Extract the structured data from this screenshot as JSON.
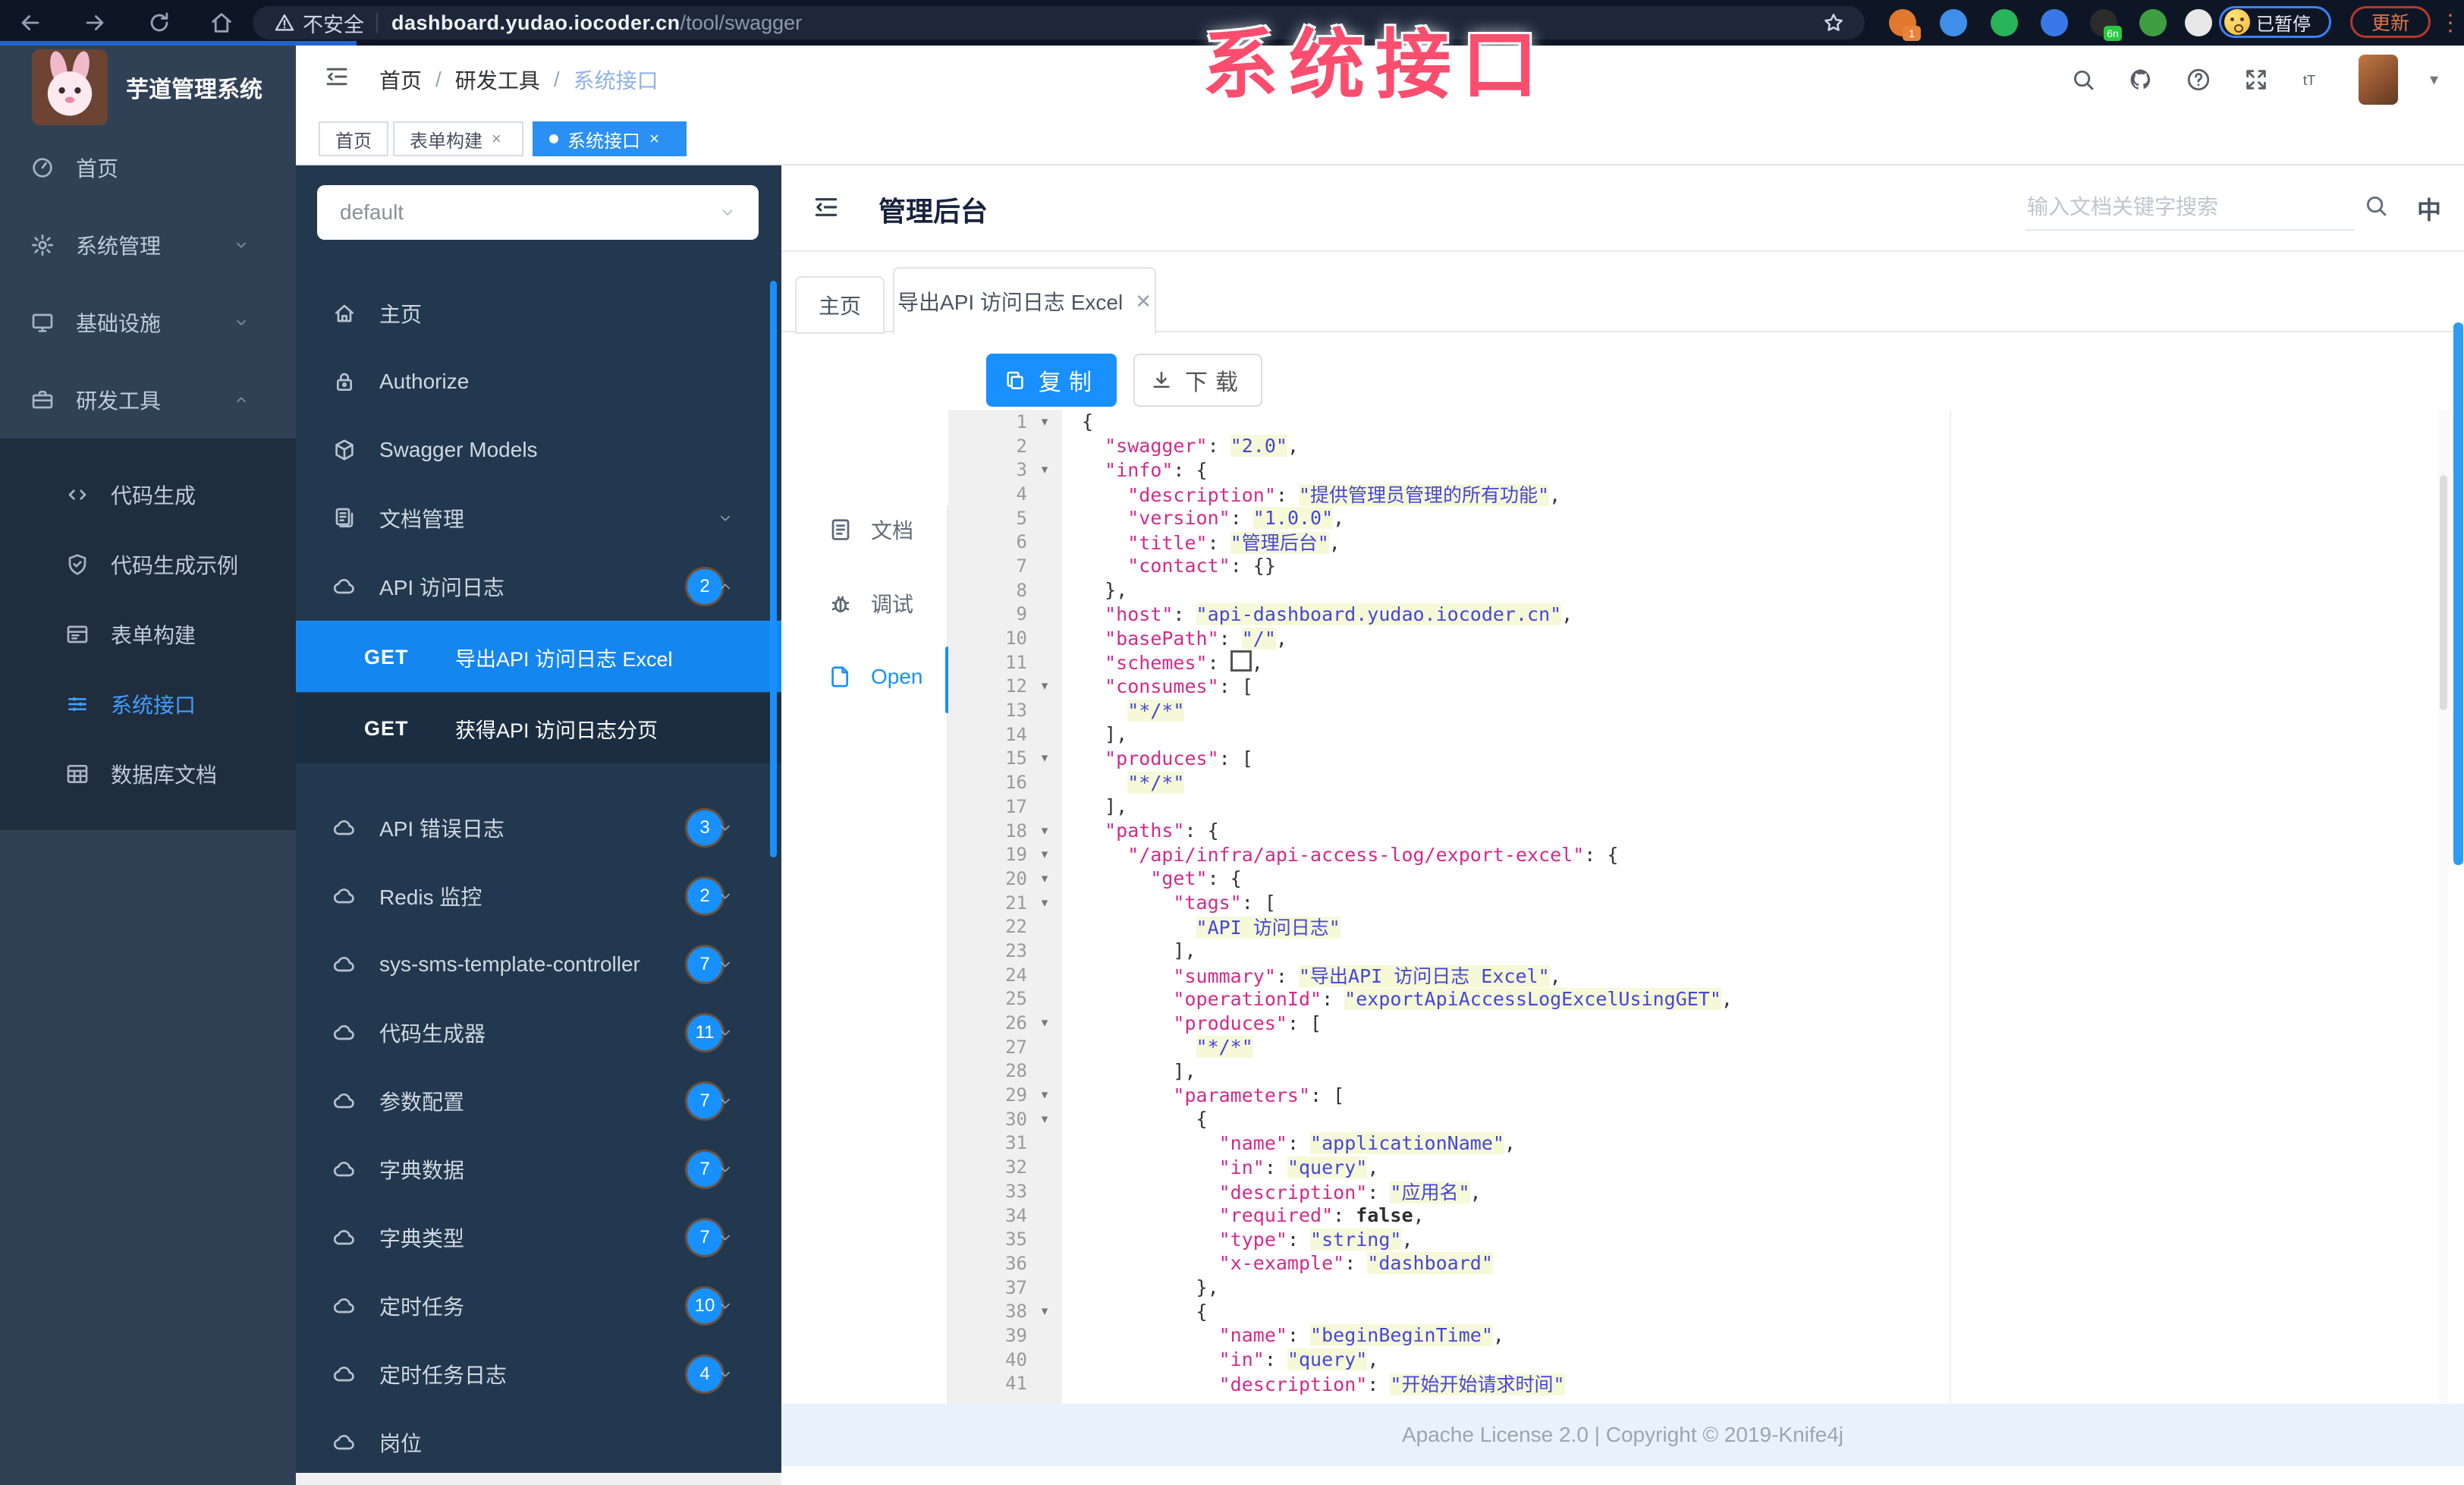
{
  "watermark": {
    "text": "系统接口"
  },
  "browser": {
    "security_label": "不安全",
    "url_host": "dashboard.yudao.iocoder.cn",
    "url_path": "/tool/swagger",
    "paused_badge": "已暂停",
    "update_label": "更新"
  },
  "app": {
    "logo_title": "芋道管理系统",
    "sidebar_items": [
      {
        "label": "首页",
        "icon": "dashboard"
      },
      {
        "label": "系统管理",
        "icon": "gear",
        "chevron": "down"
      },
      {
        "label": "基础设施",
        "icon": "monitor",
        "chevron": "down"
      },
      {
        "label": "研发工具",
        "icon": "briefcase",
        "chevron": "up"
      }
    ],
    "sidebar_sub_items": [
      {
        "label": "代码生成",
        "icon": "code"
      },
      {
        "label": "代码生成示例",
        "icon": "shield"
      },
      {
        "label": "表单构建",
        "icon": "form"
      },
      {
        "label": "系统接口",
        "icon": "api",
        "active": true
      },
      {
        "label": "数据库文档",
        "icon": "db"
      }
    ],
    "breadcrumb": [
      "首页",
      "研发工具",
      "系统接口"
    ],
    "tags": [
      {
        "label": "首页"
      },
      {
        "label": "表单构建",
        "closable": true
      },
      {
        "label": "系统接口",
        "closable": true,
        "active": true
      }
    ]
  },
  "swagger": {
    "group_select": "default",
    "menu": [
      {
        "label": "主页",
        "icon": "home"
      },
      {
        "label": "Authorize",
        "icon": "lock"
      },
      {
        "label": "Swagger Models",
        "icon": "cube"
      },
      {
        "label": "文档管理",
        "icon": "docs",
        "chevron": "down"
      },
      {
        "label": "API 访问日志",
        "icon": "cloud",
        "badge": "2",
        "chevron": "up",
        "children": [
          {
            "method": "GET",
            "label": "导出API 访问日志 Excel",
            "active": true
          },
          {
            "method": "GET",
            "label": "获得API 访问日志分页"
          }
        ]
      },
      {
        "label": "API 错误日志",
        "icon": "cloud",
        "badge": "3",
        "chevron": "down"
      },
      {
        "label": "Redis 监控",
        "icon": "cloud",
        "badge": "2",
        "chevron": "down"
      },
      {
        "label": "sys-sms-template-controller",
        "icon": "cloud",
        "badge": "7",
        "chevron": "down"
      },
      {
        "label": "代码生成器",
        "icon": "cloud",
        "badge": "11",
        "chevron": "down"
      },
      {
        "label": "参数配置",
        "icon": "cloud",
        "badge": "7",
        "chevron": "down"
      },
      {
        "label": "字典数据",
        "icon": "cloud",
        "badge": "7",
        "chevron": "down"
      },
      {
        "label": "字典类型",
        "icon": "cloud",
        "badge": "7",
        "chevron": "down"
      },
      {
        "label": "定时任务",
        "icon": "cloud",
        "badge": "10",
        "chevron": "down"
      },
      {
        "label": "定时任务日志",
        "icon": "cloud",
        "badge": "4",
        "chevron": "down"
      },
      {
        "label": "岗位",
        "icon": "cloud",
        "partial": true
      }
    ]
  },
  "content": {
    "title": "管理后台",
    "search_placeholder": "输入文档关键字搜索",
    "lang_label": "中",
    "tabs": [
      {
        "label": "主页"
      },
      {
        "label": "导出API 访问日志 Excel",
        "closable": true,
        "active": true
      }
    ],
    "doc_nav": [
      {
        "label": "文档",
        "icon": "doc"
      },
      {
        "label": "调试",
        "icon": "bug"
      },
      {
        "label": "Open",
        "icon": "openfile",
        "active": true
      }
    ],
    "toolbar": {
      "copy": "复制",
      "download": "下载"
    },
    "footer": "Apache License 2.0 | Copyright © 2019-Knife4j"
  },
  "editor": {
    "lines": [
      {
        "n": 1,
        "f": 1,
        "t": [
          [
            "p",
            "{"
          ]
        ]
      },
      {
        "n": 2,
        "t": [
          [
            "p",
            "  "
          ],
          [
            "k",
            "\"swagger\""
          ],
          [
            "p",
            ": "
          ],
          [
            "v",
            "\"2.0\""
          ],
          [
            "p",
            ","
          ]
        ]
      },
      {
        "n": 3,
        "f": 1,
        "t": [
          [
            "p",
            "  "
          ],
          [
            "k",
            "\"info\""
          ],
          [
            "p",
            ": {"
          ]
        ]
      },
      {
        "n": 4,
        "t": [
          [
            "p",
            "    "
          ],
          [
            "k",
            "\"description\""
          ],
          [
            "p",
            ": "
          ],
          [
            "v",
            "\"提供管理员管理的所有功能\""
          ],
          [
            "p",
            ","
          ]
        ]
      },
      {
        "n": 5,
        "t": [
          [
            "p",
            "    "
          ],
          [
            "k",
            "\"version\""
          ],
          [
            "p",
            ": "
          ],
          [
            "v",
            "\"1.0.0\""
          ],
          [
            "p",
            ","
          ]
        ]
      },
      {
        "n": 6,
        "t": [
          [
            "p",
            "    "
          ],
          [
            "k",
            "\"title\""
          ],
          [
            "p",
            ": "
          ],
          [
            "v",
            "\"管理后台\""
          ],
          [
            "p",
            ","
          ]
        ]
      },
      {
        "n": 7,
        "t": [
          [
            "p",
            "    "
          ],
          [
            "k",
            "\"contact\""
          ],
          [
            "p",
            ": {}"
          ]
        ]
      },
      {
        "n": 8,
        "t": [
          [
            "p",
            "  },"
          ]
        ]
      },
      {
        "n": 9,
        "t": [
          [
            "p",
            "  "
          ],
          [
            "k",
            "\"host\""
          ],
          [
            "p",
            ": "
          ],
          [
            "v",
            "\"api-dashboard.yudao.iocoder.cn\""
          ],
          [
            "p",
            ","
          ]
        ]
      },
      {
        "n": 10,
        "t": [
          [
            "p",
            "  "
          ],
          [
            "k",
            "\"basePath\""
          ],
          [
            "p",
            ": "
          ],
          [
            "v",
            "\"/\""
          ],
          [
            "p",
            ","
          ]
        ]
      },
      {
        "n": 11,
        "t": [
          [
            "p",
            "  "
          ],
          [
            "k",
            "\"schemes\""
          ],
          [
            "p",
            ": "
          ],
          [
            "w",
            ""
          ],
          [
            "p",
            ","
          ]
        ]
      },
      {
        "n": 12,
        "f": 1,
        "t": [
          [
            "p",
            "  "
          ],
          [
            "k",
            "\"consumes\""
          ],
          [
            "p",
            ": ["
          ]
        ]
      },
      {
        "n": 13,
        "t": [
          [
            "p",
            "    "
          ],
          [
            "v",
            "\"*/*\""
          ]
        ]
      },
      {
        "n": 14,
        "t": [
          [
            "p",
            "  ],"
          ]
        ]
      },
      {
        "n": 15,
        "f": 1,
        "t": [
          [
            "p",
            "  "
          ],
          [
            "k",
            "\"produces\""
          ],
          [
            "p",
            ": ["
          ]
        ]
      },
      {
        "n": 16,
        "t": [
          [
            "p",
            "    "
          ],
          [
            "v",
            "\"*/*\""
          ]
        ]
      },
      {
        "n": 17,
        "t": [
          [
            "p",
            "  ],"
          ]
        ]
      },
      {
        "n": 18,
        "f": 1,
        "t": [
          [
            "p",
            "  "
          ],
          [
            "k",
            "\"paths\""
          ],
          [
            "p",
            ": {"
          ]
        ]
      },
      {
        "n": 19,
        "f": 1,
        "t": [
          [
            "p",
            "    "
          ],
          [
            "k",
            "\"/api/infra/api-access-log/export-excel\""
          ],
          [
            "p",
            ": {"
          ]
        ]
      },
      {
        "n": 20,
        "f": 1,
        "t": [
          [
            "p",
            "      "
          ],
          [
            "k",
            "\"get\""
          ],
          [
            "p",
            ": {"
          ]
        ]
      },
      {
        "n": 21,
        "f": 1,
        "t": [
          [
            "p",
            "        "
          ],
          [
            "k",
            "\"tags\""
          ],
          [
            "p",
            ": ["
          ]
        ]
      },
      {
        "n": 22,
        "t": [
          [
            "p",
            "          "
          ],
          [
            "v",
            "\"API 访问日志\""
          ]
        ]
      },
      {
        "n": 23,
        "t": [
          [
            "p",
            "        ],"
          ]
        ]
      },
      {
        "n": 24,
        "t": [
          [
            "p",
            "        "
          ],
          [
            "k",
            "\"summary\""
          ],
          [
            "p",
            ": "
          ],
          [
            "v",
            "\"导出API 访问日志 Excel\""
          ],
          [
            "p",
            ","
          ]
        ]
      },
      {
        "n": 25,
        "t": [
          [
            "p",
            "        "
          ],
          [
            "k",
            "\"operationId\""
          ],
          [
            "p",
            ": "
          ],
          [
            "v",
            "\"exportApiAccessLogExcelUsingGET\""
          ],
          [
            "p",
            ","
          ]
        ]
      },
      {
        "n": 26,
        "f": 1,
        "t": [
          [
            "p",
            "        "
          ],
          [
            "k",
            "\"produces\""
          ],
          [
            "p",
            ": ["
          ]
        ]
      },
      {
        "n": 27,
        "t": [
          [
            "p",
            "          "
          ],
          [
            "v",
            "\"*/*\""
          ]
        ]
      },
      {
        "n": 28,
        "t": [
          [
            "p",
            "        ],"
          ]
        ]
      },
      {
        "n": 29,
        "f": 1,
        "t": [
          [
            "p",
            "        "
          ],
          [
            "k",
            "\"parameters\""
          ],
          [
            "p",
            ": ["
          ]
        ]
      },
      {
        "n": 30,
        "f": 1,
        "t": [
          [
            "p",
            "          {"
          ]
        ]
      },
      {
        "n": 31,
        "t": [
          [
            "p",
            "            "
          ],
          [
            "k",
            "\"name\""
          ],
          [
            "p",
            ": "
          ],
          [
            "v",
            "\"applicationName\""
          ],
          [
            "p",
            ","
          ]
        ]
      },
      {
        "n": 32,
        "t": [
          [
            "p",
            "            "
          ],
          [
            "k",
            "\"in\""
          ],
          [
            "p",
            ": "
          ],
          [
            "v",
            "\"query\""
          ],
          [
            "p",
            ","
          ]
        ]
      },
      {
        "n": 33,
        "t": [
          [
            "p",
            "            "
          ],
          [
            "k",
            "\"description\""
          ],
          [
            "p",
            ": "
          ],
          [
            "v",
            "\"应用名\""
          ],
          [
            "p",
            ","
          ]
        ]
      },
      {
        "n": 34,
        "t": [
          [
            "p",
            "            "
          ],
          [
            "k",
            "\"required\""
          ],
          [
            "p",
            ": "
          ],
          [
            "b",
            "false"
          ],
          [
            "p",
            ","
          ]
        ]
      },
      {
        "n": 35,
        "t": [
          [
            "p",
            "            "
          ],
          [
            "k",
            "\"type\""
          ],
          [
            "p",
            ": "
          ],
          [
            "v",
            "\"string\""
          ],
          [
            "p",
            ","
          ]
        ]
      },
      {
        "n": 36,
        "t": [
          [
            "p",
            "            "
          ],
          [
            "k",
            "\"x-example\""
          ],
          [
            "p",
            ": "
          ],
          [
            "v",
            "\"dashboard\""
          ]
        ]
      },
      {
        "n": 37,
        "t": [
          [
            "p",
            "          },"
          ]
        ]
      },
      {
        "n": 38,
        "f": 1,
        "t": [
          [
            "p",
            "          {"
          ]
        ]
      },
      {
        "n": 39,
        "t": [
          [
            "p",
            "            "
          ],
          [
            "k",
            "\"name\""
          ],
          [
            "p",
            ": "
          ],
          [
            "v",
            "\"beginBeginTime\""
          ],
          [
            "p",
            ","
          ]
        ]
      },
      {
        "n": 40,
        "t": [
          [
            "p",
            "            "
          ],
          [
            "k",
            "\"in\""
          ],
          [
            "p",
            ": "
          ],
          [
            "v",
            "\"query\""
          ],
          [
            "p",
            ","
          ]
        ]
      },
      {
        "n": 41,
        "t": [
          [
            "p",
            "            "
          ],
          [
            "k",
            "\"description\""
          ],
          [
            "p",
            ": "
          ],
          [
            "v",
            "\"开始开始请求时间\""
          ]
        ]
      }
    ]
  }
}
